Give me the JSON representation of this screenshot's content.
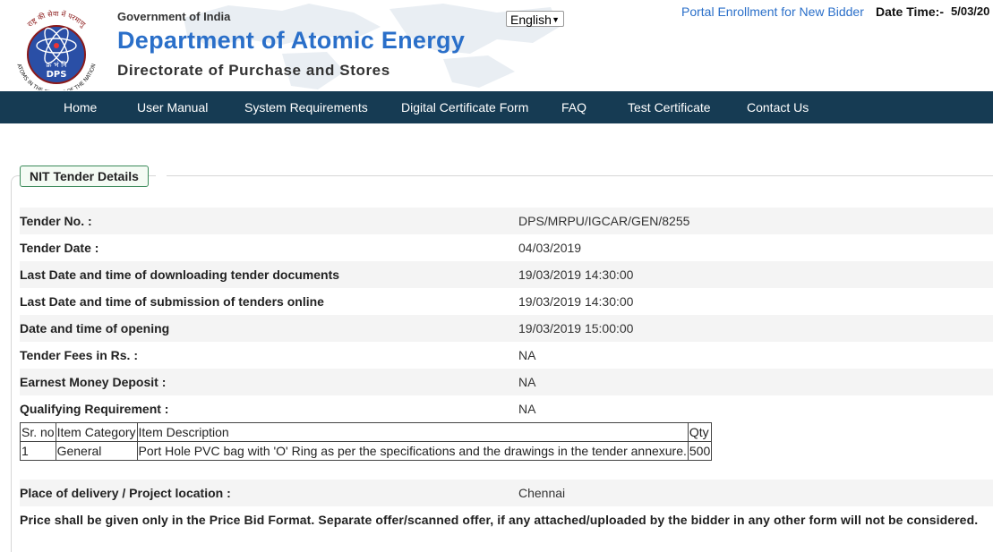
{
  "header": {
    "logo_text_top": "राष्ट्र की सेवा में परमाणु",
    "logo_text_bottom": "ATOMS IN THE SERVICE OF THE NATION",
    "logo_hindi": "क्र भं नि",
    "logo_abbr": "DPS",
    "gov": "Government of India",
    "dept": "Department of Atomic Energy",
    "directorate": "Directorate of Purchase and Stores",
    "language": "English",
    "portal_link": "Portal Enrollment for New Bidder",
    "datetime_label": "Date Time:-",
    "datetime_value": "5/03/20"
  },
  "nav": [
    "Home",
    "User Manual",
    "System Requirements",
    "Digital Certificate Form",
    "FAQ",
    "Test Certificate",
    "Contact Us"
  ],
  "section_title": "NIT Tender Details",
  "details": [
    {
      "label": "Tender No. :",
      "value": "DPS/MRPU/IGCAR/GEN/8255"
    },
    {
      "label": "Tender Date :",
      "value": "04/03/2019"
    },
    {
      "label": "Last Date and time of downloading tender documents",
      "value": "19/03/2019 14:30:00"
    },
    {
      "label": "Last Date and time of submission of tenders online",
      "value": "19/03/2019 14:30:00"
    },
    {
      "label": "Date and time of opening",
      "value": "19/03/2019 15:00:00"
    },
    {
      "label": "Tender Fees in Rs. :",
      "value": "NA"
    },
    {
      "label": "Earnest Money Deposit :",
      "value": "NA"
    },
    {
      "label": "Qualifying Requirement :",
      "value": "NA"
    }
  ],
  "items_table": {
    "headers": [
      "Sr. no",
      "Item Category",
      "Item Description",
      "Qty"
    ],
    "rows": [
      [
        "1",
        "General",
        "Port Hole PVC bag with 'O' Ring as per the specifications and the drawings in the tender annexure.",
        "500"
      ]
    ]
  },
  "delivery": {
    "label": "Place of delivery / Project location :",
    "value": "Chennai"
  },
  "note": "Price shall be given only in the Price Bid Format. Separate offer/scanned offer, if any attached/uploaded by the bidder in any other form will not be considered.",
  "colors": {
    "nav_bg": "#163b53",
    "brand_blue": "#2a6fc9",
    "legend_border": "#3b8a5a"
  }
}
